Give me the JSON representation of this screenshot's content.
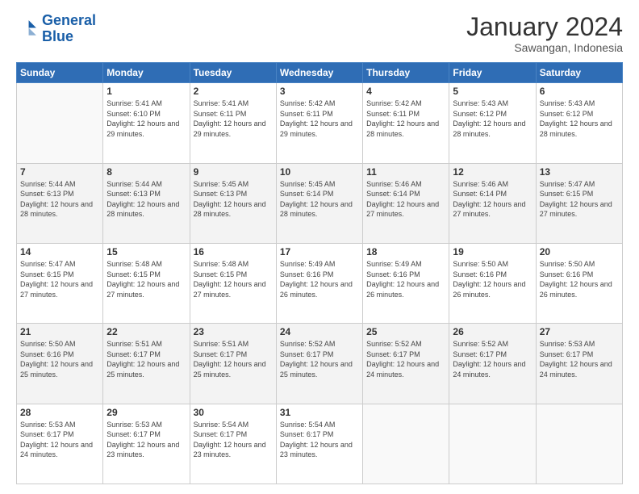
{
  "logo": {
    "line1": "General",
    "line2": "Blue"
  },
  "header": {
    "month": "January 2024",
    "location": "Sawangan, Indonesia"
  },
  "days_header": [
    "Sunday",
    "Monday",
    "Tuesday",
    "Wednesday",
    "Thursday",
    "Friday",
    "Saturday"
  ],
  "weeks": [
    [
      {
        "day": "",
        "sunrise": "",
        "sunset": "",
        "daylight": ""
      },
      {
        "day": "1",
        "sunrise": "Sunrise: 5:41 AM",
        "sunset": "Sunset: 6:10 PM",
        "daylight": "Daylight: 12 hours and 29 minutes."
      },
      {
        "day": "2",
        "sunrise": "Sunrise: 5:41 AM",
        "sunset": "Sunset: 6:11 PM",
        "daylight": "Daylight: 12 hours and 29 minutes."
      },
      {
        "day": "3",
        "sunrise": "Sunrise: 5:42 AM",
        "sunset": "Sunset: 6:11 PM",
        "daylight": "Daylight: 12 hours and 29 minutes."
      },
      {
        "day": "4",
        "sunrise": "Sunrise: 5:42 AM",
        "sunset": "Sunset: 6:11 PM",
        "daylight": "Daylight: 12 hours and 28 minutes."
      },
      {
        "day": "5",
        "sunrise": "Sunrise: 5:43 AM",
        "sunset": "Sunset: 6:12 PM",
        "daylight": "Daylight: 12 hours and 28 minutes."
      },
      {
        "day": "6",
        "sunrise": "Sunrise: 5:43 AM",
        "sunset": "Sunset: 6:12 PM",
        "daylight": "Daylight: 12 hours and 28 minutes."
      }
    ],
    [
      {
        "day": "7",
        "sunrise": "Sunrise: 5:44 AM",
        "sunset": "Sunset: 6:13 PM",
        "daylight": "Daylight: 12 hours and 28 minutes."
      },
      {
        "day": "8",
        "sunrise": "Sunrise: 5:44 AM",
        "sunset": "Sunset: 6:13 PM",
        "daylight": "Daylight: 12 hours and 28 minutes."
      },
      {
        "day": "9",
        "sunrise": "Sunrise: 5:45 AM",
        "sunset": "Sunset: 6:13 PM",
        "daylight": "Daylight: 12 hours and 28 minutes."
      },
      {
        "day": "10",
        "sunrise": "Sunrise: 5:45 AM",
        "sunset": "Sunset: 6:14 PM",
        "daylight": "Daylight: 12 hours and 28 minutes."
      },
      {
        "day": "11",
        "sunrise": "Sunrise: 5:46 AM",
        "sunset": "Sunset: 6:14 PM",
        "daylight": "Daylight: 12 hours and 27 minutes."
      },
      {
        "day": "12",
        "sunrise": "Sunrise: 5:46 AM",
        "sunset": "Sunset: 6:14 PM",
        "daylight": "Daylight: 12 hours and 27 minutes."
      },
      {
        "day": "13",
        "sunrise": "Sunrise: 5:47 AM",
        "sunset": "Sunset: 6:15 PM",
        "daylight": "Daylight: 12 hours and 27 minutes."
      }
    ],
    [
      {
        "day": "14",
        "sunrise": "Sunrise: 5:47 AM",
        "sunset": "Sunset: 6:15 PM",
        "daylight": "Daylight: 12 hours and 27 minutes."
      },
      {
        "day": "15",
        "sunrise": "Sunrise: 5:48 AM",
        "sunset": "Sunset: 6:15 PM",
        "daylight": "Daylight: 12 hours and 27 minutes."
      },
      {
        "day": "16",
        "sunrise": "Sunrise: 5:48 AM",
        "sunset": "Sunset: 6:15 PM",
        "daylight": "Daylight: 12 hours and 27 minutes."
      },
      {
        "day": "17",
        "sunrise": "Sunrise: 5:49 AM",
        "sunset": "Sunset: 6:16 PM",
        "daylight": "Daylight: 12 hours and 26 minutes."
      },
      {
        "day": "18",
        "sunrise": "Sunrise: 5:49 AM",
        "sunset": "Sunset: 6:16 PM",
        "daylight": "Daylight: 12 hours and 26 minutes."
      },
      {
        "day": "19",
        "sunrise": "Sunrise: 5:50 AM",
        "sunset": "Sunset: 6:16 PM",
        "daylight": "Daylight: 12 hours and 26 minutes."
      },
      {
        "day": "20",
        "sunrise": "Sunrise: 5:50 AM",
        "sunset": "Sunset: 6:16 PM",
        "daylight": "Daylight: 12 hours and 26 minutes."
      }
    ],
    [
      {
        "day": "21",
        "sunrise": "Sunrise: 5:50 AM",
        "sunset": "Sunset: 6:16 PM",
        "daylight": "Daylight: 12 hours and 25 minutes."
      },
      {
        "day": "22",
        "sunrise": "Sunrise: 5:51 AM",
        "sunset": "Sunset: 6:17 PM",
        "daylight": "Daylight: 12 hours and 25 minutes."
      },
      {
        "day": "23",
        "sunrise": "Sunrise: 5:51 AM",
        "sunset": "Sunset: 6:17 PM",
        "daylight": "Daylight: 12 hours and 25 minutes."
      },
      {
        "day": "24",
        "sunrise": "Sunrise: 5:52 AM",
        "sunset": "Sunset: 6:17 PM",
        "daylight": "Daylight: 12 hours and 25 minutes."
      },
      {
        "day": "25",
        "sunrise": "Sunrise: 5:52 AM",
        "sunset": "Sunset: 6:17 PM",
        "daylight": "Daylight: 12 hours and 24 minutes."
      },
      {
        "day": "26",
        "sunrise": "Sunrise: 5:52 AM",
        "sunset": "Sunset: 6:17 PM",
        "daylight": "Daylight: 12 hours and 24 minutes."
      },
      {
        "day": "27",
        "sunrise": "Sunrise: 5:53 AM",
        "sunset": "Sunset: 6:17 PM",
        "daylight": "Daylight: 12 hours and 24 minutes."
      }
    ],
    [
      {
        "day": "28",
        "sunrise": "Sunrise: 5:53 AM",
        "sunset": "Sunset: 6:17 PM",
        "daylight": "Daylight: 12 hours and 24 minutes."
      },
      {
        "day": "29",
        "sunrise": "Sunrise: 5:53 AM",
        "sunset": "Sunset: 6:17 PM",
        "daylight": "Daylight: 12 hours and 23 minutes."
      },
      {
        "day": "30",
        "sunrise": "Sunrise: 5:54 AM",
        "sunset": "Sunset: 6:17 PM",
        "daylight": "Daylight: 12 hours and 23 minutes."
      },
      {
        "day": "31",
        "sunrise": "Sunrise: 5:54 AM",
        "sunset": "Sunset: 6:17 PM",
        "daylight": "Daylight: 12 hours and 23 minutes."
      },
      {
        "day": "",
        "sunrise": "",
        "sunset": "",
        "daylight": ""
      },
      {
        "day": "",
        "sunrise": "",
        "sunset": "",
        "daylight": ""
      },
      {
        "day": "",
        "sunrise": "",
        "sunset": "",
        "daylight": ""
      }
    ]
  ]
}
